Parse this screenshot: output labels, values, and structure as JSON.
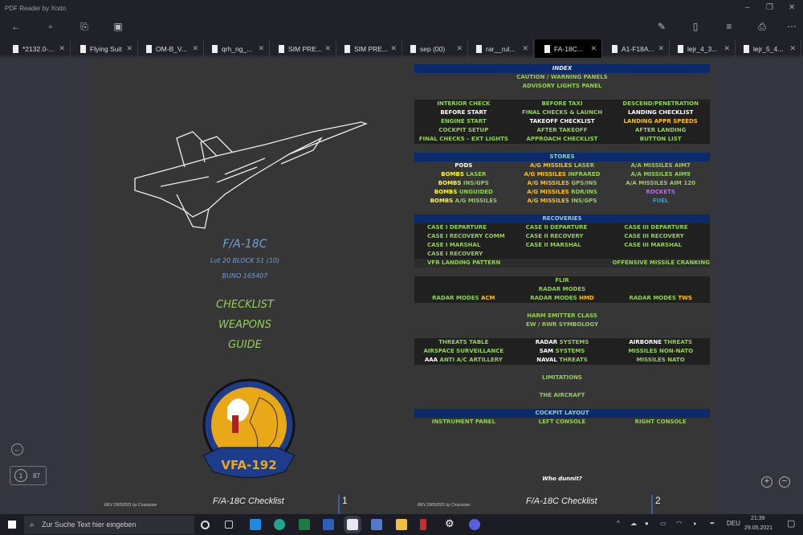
{
  "app": {
    "title": "PDF Reader by Xodo"
  },
  "tabs": [
    {
      "label": "*2132.0-..."
    },
    {
      "label": "Flying Suit"
    },
    {
      "label": "OM-B_V..."
    },
    {
      "label": "qrh_ng_..."
    },
    {
      "label": "SIM PRE..."
    },
    {
      "label": "SIM PRE..."
    },
    {
      "label": "sep (00)"
    },
    {
      "label": "rar__rul..."
    },
    {
      "label": "FA-18C...",
      "active": true
    },
    {
      "label": "A1-F18A..."
    },
    {
      "label": "lejr_4_3..."
    },
    {
      "label": "lejr_5_4..."
    }
  ],
  "colors": {
    "g": "#92d050",
    "w": "#ffffff",
    "y": "#ffff00",
    "o": "#ffc000",
    "p": "#b070e0",
    "b": "#00b0f0",
    "h": "#8fd0c8",
    "hw": "#e8ecff"
  },
  "page1": {
    "model": "F/A-18C",
    "lot": "Lot 20 BLOCK 51 (10)",
    "buno": "BUNO 165407",
    "lines": [
      "CHECKLIST",
      "WEAPONS",
      "GUIDE"
    ],
    "emblem_text": "VFA-192",
    "rev": "REV 29052021 by Cruizzzzer",
    "footer_title": "F/A-18C Checklist",
    "page_no": "1"
  },
  "page2": {
    "rev": "REV 29052021 by Cruizzzzer",
    "footer_title": "F/A-18C Checklist",
    "page_no": "2",
    "who": "Who dunnit?",
    "sections": [
      {
        "header": "INDEX",
        "rows": [
          {
            "c": [
              [
                "CAUTION / WARNING PANELS",
                "g"
              ]
            ]
          },
          {
            "c": [
              [
                "ADVISORY LIGHTS PANEL",
                "g"
              ]
            ]
          }
        ]
      },
      {
        "rows": [
          {
            "cols": [
              [
                [
                  "INTERIOR CHECK",
                  "g"
                ]
              ],
              [
                [
                  "BEFORE TAXI",
                  "g"
                ]
              ],
              [
                [
                  "DESCEND/PENETRATION",
                  "g"
                ]
              ]
            ]
          },
          {
            "cols": [
              [
                [
                  "BEFORE START",
                  "w"
                ]
              ],
              [
                [
                  "FINAL CHECKS & LAUNCH",
                  "g"
                ]
              ],
              [
                [
                  "LANDING CHECKLIST",
                  "w"
                ]
              ]
            ]
          },
          {
            "cols": [
              [
                [
                  "ENGINE START",
                  "g"
                ]
              ],
              [
                [
                  "TAKEOFF CHECKLIST",
                  "w"
                ]
              ],
              [
                [
                  "LANDING APPR SPEEDS",
                  "o"
                ]
              ]
            ]
          },
          {
            "cols": [
              [
                [
                  "COCKPIT SETUP",
                  "g"
                ]
              ],
              [
                [
                  "AFTER TAKEOFF",
                  "g"
                ]
              ],
              [
                [
                  "AFTER LANDING",
                  "g"
                ]
              ]
            ]
          },
          {
            "cols": [
              [
                [
                  "FINAL CHECKS – EXT LIGHTS",
                  "g"
                ]
              ],
              [
                [
                  "APPROACH CHECKLIST",
                  "g"
                ]
              ],
              [
                [
                  "BUTTON LIST",
                  "g"
                ]
              ]
            ]
          }
        ]
      },
      {
        "header": "STORES",
        "rows": [
          {
            "cols": [
              [
                [
                  "PODS",
                  "w"
                ]
              ],
              [
                [
                  "A/G MISSILES ",
                  "o"
                ],
                [
                  "LASER",
                  "g"
                ]
              ],
              [
                [
                  "A/A MISSILES AIM7",
                  "g"
                ]
              ]
            ]
          },
          {
            "cols": [
              [
                [
                  "BOMBS ",
                  "y"
                ],
                [
                  "LASER",
                  "g"
                ]
              ],
              [
                [
                  "A/G MISSILES ",
                  "o"
                ],
                [
                  "INFRARED",
                  "g"
                ]
              ],
              [
                [
                  "A/A MISSILES AIM9",
                  "g"
                ]
              ]
            ]
          },
          {
            "cols": [
              [
                [
                  "BOMBS ",
                  "y"
                ],
                [
                  "INS/GPS",
                  "g"
                ]
              ],
              [
                [
                  "A/G MISSILES ",
                  "o"
                ],
                [
                  "GPS/INS",
                  "g"
                ]
              ],
              [
                [
                  "A/A MISSILES AIM 120",
                  "g"
                ]
              ]
            ]
          },
          {
            "cols": [
              [
                [
                  "BOMBS ",
                  "y"
                ],
                [
                  "UNGUIDED",
                  "g"
                ]
              ],
              [
                [
                  "A/G MISSILES ",
                  "o"
                ],
                [
                  "RDR/INS",
                  "g"
                ]
              ],
              [
                [
                  "ROCKETS",
                  "p"
                ]
              ]
            ]
          },
          {
            "cols": [
              [
                [
                  "BOMBS ",
                  "y"
                ],
                [
                  "A/G MISSILES",
                  "g"
                ]
              ],
              [
                [
                  "A/G MISSILES ",
                  "o"
                ],
                [
                  "INS/GPS",
                  "g"
                ]
              ],
              [
                [
                  "FUEL",
                  "b"
                ]
              ]
            ]
          }
        ]
      },
      {
        "header": "RECOVERIES",
        "rows": [
          {
            "cols": [
              [
                [
                  "CASE I DEPARTURE",
                  "g"
                ]
              ],
              [
                [
                  "CASE II DEPARTURE",
                  "g"
                ]
              ],
              [
                [
                  "CASE III DEPARTURE",
                  "g"
                ]
              ]
            ]
          },
          {
            "cols": [
              [
                [
                  "CASE I RECOVERY COMM",
                  "g"
                ]
              ],
              [
                [
                  "CASE II RECOVERY",
                  "g"
                ]
              ],
              [
                [
                  "CASE III RECOVERY",
                  "g"
                ]
              ]
            ]
          },
          {
            "cols": [
              [
                [
                  "CASE I MARSHAL",
                  "g"
                ]
              ],
              [
                [
                  "CASE II MARSHAL",
                  "g"
                ]
              ],
              [
                [
                  "CASE III MARSHAL",
                  "g"
                ]
              ]
            ]
          },
          {
            "cols": [
              [
                [
                  "CASE I RECOVERY",
                  "g"
                ]
              ],
              [],
              []
            ]
          },
          {
            "cols": [
              [
                [
                  "VFR LANDING PATTERN",
                  "g"
                ]
              ],
              [],
              [
                [
                  "OFFENSIVE MISSILE CRANKING",
                  "g"
                ]
              ]
            ]
          }
        ]
      },
      {
        "rows": [
          {
            "c": [
              [
                "FLIR",
                "g"
              ]
            ]
          },
          {
            "c": [
              [
                "RADAR MODES",
                "g"
              ]
            ]
          },
          {
            "cols": [
              [
                [
                  "RADAR MODES ",
                  "g"
                ],
                [
                  "ACM",
                  "o"
                ]
              ],
              [
                [
                  "RADAR MODES ",
                  "g"
                ],
                [
                  "HMD",
                  "o"
                ]
              ],
              [
                [
                  "RADAR MODES ",
                  "g"
                ],
                [
                  "TWS",
                  "o"
                ]
              ]
            ]
          }
        ]
      },
      {
        "rows": [
          {
            "c": [
              [
                "HARM EMITTER CLASS",
                "g"
              ]
            ]
          },
          {
            "c": [
              [
                "EW / RWR SYMBOLOGY",
                "g"
              ]
            ]
          }
        ]
      },
      {
        "rows": [
          {
            "cols": [
              [
                [
                  "THREATS TABLE",
                  "g"
                ]
              ],
              [
                [
                  "RADAR ",
                  "w"
                ],
                [
                  "SYSTEMS",
                  "g"
                ]
              ],
              [
                [
                  "AIRBORNE ",
                  "w"
                ],
                [
                  "THREATS",
                  "g"
                ]
              ]
            ]
          },
          {
            "cols": [
              [
                [
                  "AIRSPACE SURVEILLANCE",
                  "g"
                ]
              ],
              [
                [
                  "SAM ",
                  "w"
                ],
                [
                  "SYSTEMS",
                  "g"
                ]
              ],
              [
                [
                  "MISSILES NON-NATO",
                  "g"
                ]
              ]
            ]
          },
          {
            "cols": [
              [
                [
                  "AAA ",
                  "w"
                ],
                [
                  "ANTI A/C ARTILLERY",
                  "g"
                ]
              ],
              [
                [
                  "NAVAL ",
                  "w"
                ],
                [
                  "THREATS",
                  "g"
                ]
              ],
              [
                [
                  "MISSILES NATO",
                  "g"
                ]
              ]
            ]
          }
        ]
      },
      {
        "rows": [
          {
            "c": [
              [
                "LIMITATIONS",
                "g"
              ]
            ]
          }
        ]
      },
      {
        "rows": [
          {
            "c": [
              [
                "THE AIRCRAFT",
                "g"
              ]
            ]
          }
        ]
      },
      {
        "header": "COCKPIT LAYOUT",
        "rows": [
          {
            "cols": [
              [
                [
                  "INSTRUMENT PANEL",
                  "g"
                ]
              ],
              [
                [
                  "LEFT CONSOLE",
                  "g"
                ]
              ],
              [
                [
                  "RIGHT CONSOLE",
                  "g"
                ]
              ]
            ]
          }
        ]
      }
    ]
  },
  "nav": {
    "current_page": "1",
    "total_pages": "87"
  },
  "taskbar": {
    "search_placeholder": "Zur Suche Text hier eingeben",
    "lang": "DEU",
    "time": "21:39",
    "date": "29.05.2021"
  }
}
